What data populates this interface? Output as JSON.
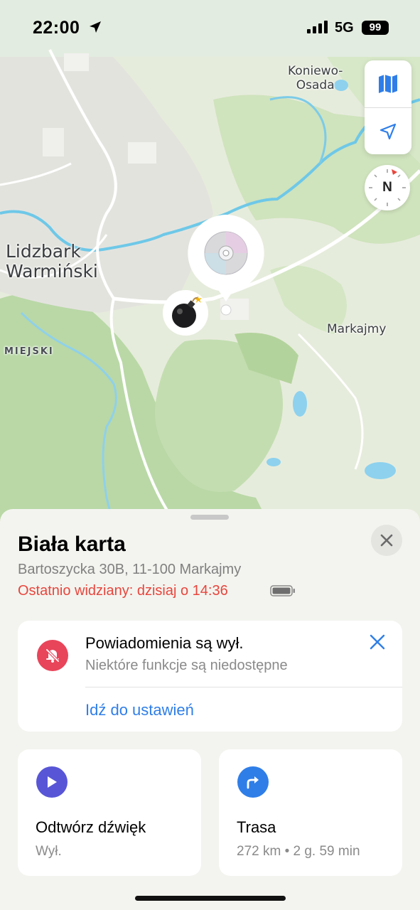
{
  "status_bar": {
    "time": "22:00",
    "network": "5G",
    "battery": "99"
  },
  "map": {
    "labels": {
      "town_line1": "Lidzbark",
      "town_line2": "Warmiński",
      "koniewo_line1": "Koniewo-",
      "koniewo_line2": "Osada",
      "markajmy": "Markajmy",
      "miejski": "MIEJSKI"
    },
    "compass_label": "N",
    "controls": [
      "map-icon",
      "location-arrow-icon"
    ],
    "pins": [
      "cd-disc-icon",
      "bomb-icon"
    ]
  },
  "sheet": {
    "title": "Biała karta",
    "address": "Bartoszycka 30B, 11-100 Markajmy",
    "last_seen": "Ostatnio widziany: dzisiaj o 14:36",
    "notification": {
      "title": "Powiadomienia są wył.",
      "subtitle": "Niektóre funkcje są niedostępne",
      "link": "Idź do ustawień"
    },
    "actions": {
      "play": {
        "title": "Odtwórz dźwięk",
        "subtitle": "Wył."
      },
      "route": {
        "title": "Trasa",
        "subtitle": "272 km • 2 g. 59 min"
      }
    }
  },
  "colors": {
    "accent_blue": "#2f7ee8",
    "alert_red": "#e8453c",
    "play_purple": "#5856d6",
    "notif_icon_red": "#e8455a"
  }
}
